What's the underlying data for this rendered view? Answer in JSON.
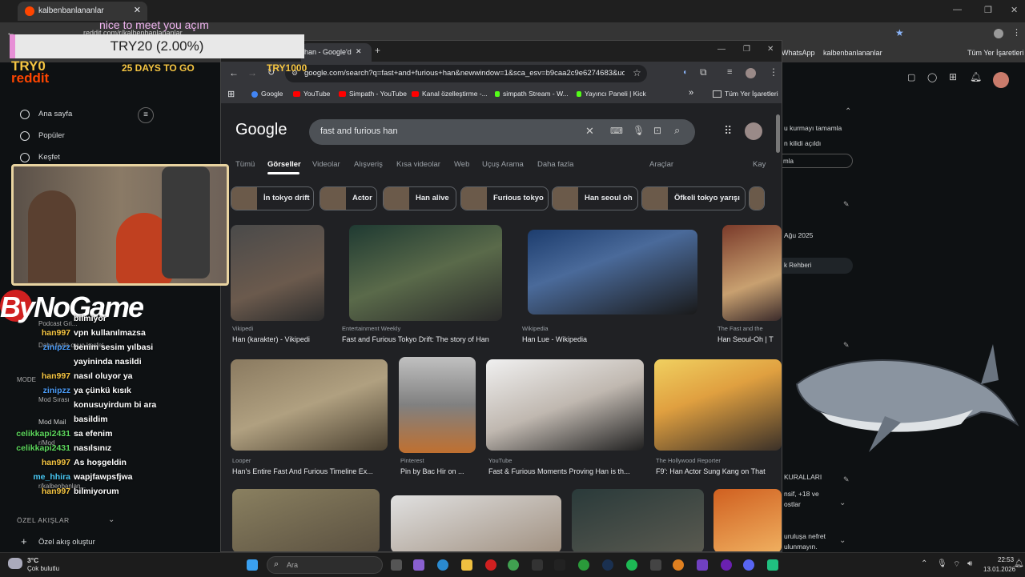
{
  "back_browser": {
    "tab_title": "kalbenbanlananlar",
    "url": "reddit.com/r/kalbenbanlananlar",
    "bookmarks": [
      "WhatsApp",
      "kalbenbanlananlar",
      "Tüm Yer İşaretleri"
    ]
  },
  "reddit_sidebar": {
    "items": [
      {
        "label": "Ana sayfa",
        "icon": "home-icon"
      },
      {
        "label": "Popüler",
        "icon": "popular-icon"
      },
      {
        "label": "Keşfet",
        "icon": "explore-icon"
      }
    ],
    "partial_items": [
      "Podcast Gri...",
      "Daha fazla oyun keşfet",
      "MODE",
      "Mod Sırası",
      "Mod Mail",
      "r/Mod",
      "r/kalbenbanlan..."
    ],
    "section_feeds": "ÖZEL AKIŞLAR",
    "create_feed": "Özel akış oluştur"
  },
  "reddit_right": {
    "lines": [
      "u kurmayı tamamla",
      "n kilidi açıldı",
      "mla",
      "Ağu 2025",
      "k Rehberi",
      "KURALLARI",
      "nsif, +18 ve",
      "ostlar",
      "uruluşa nefret",
      "ulunmayın."
    ]
  },
  "front_browser": {
    "tab_title": "han - Google'd",
    "url": "google.com/search?q=fast+and+furious+han&newwindow=1&sca_esv=b9caa2c9e6274683&udm=2...",
    "bookmarks": [
      {
        "label": "Google",
        "color": "#4285f4"
      },
      {
        "label": "YouTube",
        "color": "#ff0000"
      },
      {
        "label": "Simpath - YouTube",
        "color": "#ff0000"
      },
      {
        "label": "Kanal özelleştirme -...",
        "color": "#ff0000"
      },
      {
        "label": "simpath Stream - W...",
        "color": "#53fc18"
      },
      {
        "label": "Yayıncı Paneli | Kick",
        "color": "#53fc18"
      }
    ],
    "all_bookmarks": "Tüm Yer İşaretleri"
  },
  "google": {
    "logo": "Google",
    "query": "fast and furious han",
    "tabs": [
      "Tümü",
      "Görseller",
      "Videolar",
      "Alışveriş",
      "Kısa videolar",
      "Web",
      "Uçuş Arama",
      "Daha fazla"
    ],
    "active_tab": "Görseller",
    "tools": "Araçlar",
    "save": "Kay",
    "chips": [
      "İn tokyo drift",
      "Actor",
      "Han alive",
      "Furious tokyo",
      "Han seoul oh",
      "Öfkeli tokyo yarışı"
    ],
    "results_row1": [
      {
        "source": "Vikipedi",
        "caption": "Han (karakter) - Vikipedi"
      },
      {
        "source": "Entertainment Weekly",
        "caption": "Fast and Furious Tokyo Drift: The story of Han"
      },
      {
        "source": "Wikipedia",
        "caption": "Han Lue - Wikipedia"
      },
      {
        "source": "The Fast and the",
        "caption": "Han Seoul-Oh | T"
      }
    ],
    "results_row2": [
      {
        "source": "Looper",
        "caption": "Han's Entire Fast And Furious Timeline Ex..."
      },
      {
        "source": "Pinterest",
        "caption": "Pin by Bac Hir on ..."
      },
      {
        "source": "YouTube",
        "caption": "Fast & Furious Moments Proving Han is th..."
      },
      {
        "source": "The Hollywood Reporter",
        "caption": "F9': Han Actor Sung Kang on That"
      }
    ]
  },
  "overlay": {
    "donation_title": "nice to meet you açım",
    "donation_bar": "TRY20 (2.00%)",
    "donation_percent": 2.0,
    "days_left": "25 DAYS TO GO",
    "goal_amount": "TRY1000",
    "try0": "TRY0",
    "reddit_word": "reddit",
    "sponsor": "ByNoGame"
  },
  "chat": [
    {
      "user": "",
      "msg": "bilmiyor",
      "cls": ""
    },
    {
      "user": "han997",
      "msg": "vpn kullanılmazsa",
      "cls": "u1"
    },
    {
      "user": "zinipzz",
      "msg": "benim sesim yılbasi",
      "cls": "u2"
    },
    {
      "user": "",
      "msg": "yayininda nasildi",
      "cls": ""
    },
    {
      "user": "han997",
      "msg": "nasıl oluyor ya",
      "cls": "u1"
    },
    {
      "user": "zinipzz",
      "msg": "ya çünkü kısık",
      "cls": "u2"
    },
    {
      "user": "",
      "msg": "konusuyirdum bi ara",
      "cls": ""
    },
    {
      "user": "",
      "msg": "basildim",
      "cls": ""
    },
    {
      "user": "celikkapi2431",
      "msg": "sa efenim",
      "cls": "u3"
    },
    {
      "user": "celikkapi2431",
      "msg": "nasılsınız",
      "cls": "u3"
    },
    {
      "user": "han997",
      "msg": "As hoşgeldin",
      "cls": "u1"
    },
    {
      "user": "me_hhira",
      "msg": "wapjfawpsfjwa",
      "cls": "u4"
    },
    {
      "user": "han997",
      "msg": "bilmiyorum",
      "cls": "u1"
    }
  ],
  "taskbar": {
    "weather_temp": "3°C",
    "weather_desc": "Çok bulutlu",
    "search_placeholder": "Ara",
    "time": "22:53",
    "date": "13.01.2026"
  }
}
